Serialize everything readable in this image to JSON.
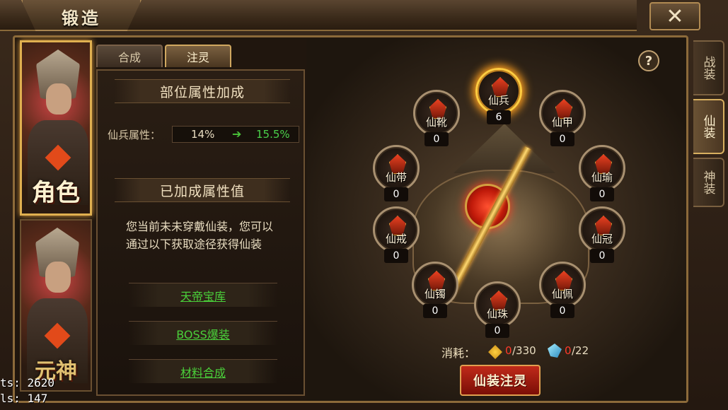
{
  "window": {
    "title": "锻造",
    "close_icon": "✕"
  },
  "debug": {
    "line1": "ts:   2620",
    "line2": "ls:    147"
  },
  "portraits": [
    {
      "label": "角色",
      "active": true
    },
    {
      "label": "元神",
      "active": false
    }
  ],
  "tabs": [
    {
      "label": "合成",
      "active": false
    },
    {
      "label": "注灵",
      "active": true
    }
  ],
  "info": {
    "section1_title": "部位属性加成",
    "attr_label": "仙兵属性：",
    "attr_old": "14%",
    "attr_arrow": "➔",
    "attr_new": "15.5%",
    "section2_title": "已加成属性值",
    "notice": "您当前未未穿戴仙装，您可以通过以下获取途径获得仙装",
    "links": [
      "天帝宝库",
      "BOSS爆装",
      "材料合成"
    ]
  },
  "help": {
    "label": "?"
  },
  "slots": [
    {
      "name": "仙兵",
      "count": "6",
      "highlight": true
    },
    {
      "name": "仙靴",
      "count": "0"
    },
    {
      "name": "仙甲",
      "count": "0"
    },
    {
      "name": "仙带",
      "count": "0"
    },
    {
      "name": "仙瑜",
      "count": "0"
    },
    {
      "name": "仙戒",
      "count": "0"
    },
    {
      "name": "仙冠",
      "count": "0"
    },
    {
      "name": "仙镯",
      "count": "0"
    },
    {
      "name": "仙珠",
      "count": "0"
    },
    {
      "name": "仙佩",
      "count": "0"
    }
  ],
  "cost": {
    "label": "消耗：",
    "gold_current": "0",
    "gold_max": "/330",
    "crystal_current": "0",
    "crystal_max": "/22"
  },
  "action_button": "仙装注灵",
  "side_tabs": [
    {
      "label": "战装",
      "active": false
    },
    {
      "label": "仙装",
      "active": true
    },
    {
      "label": "神装",
      "active": false
    }
  ]
}
